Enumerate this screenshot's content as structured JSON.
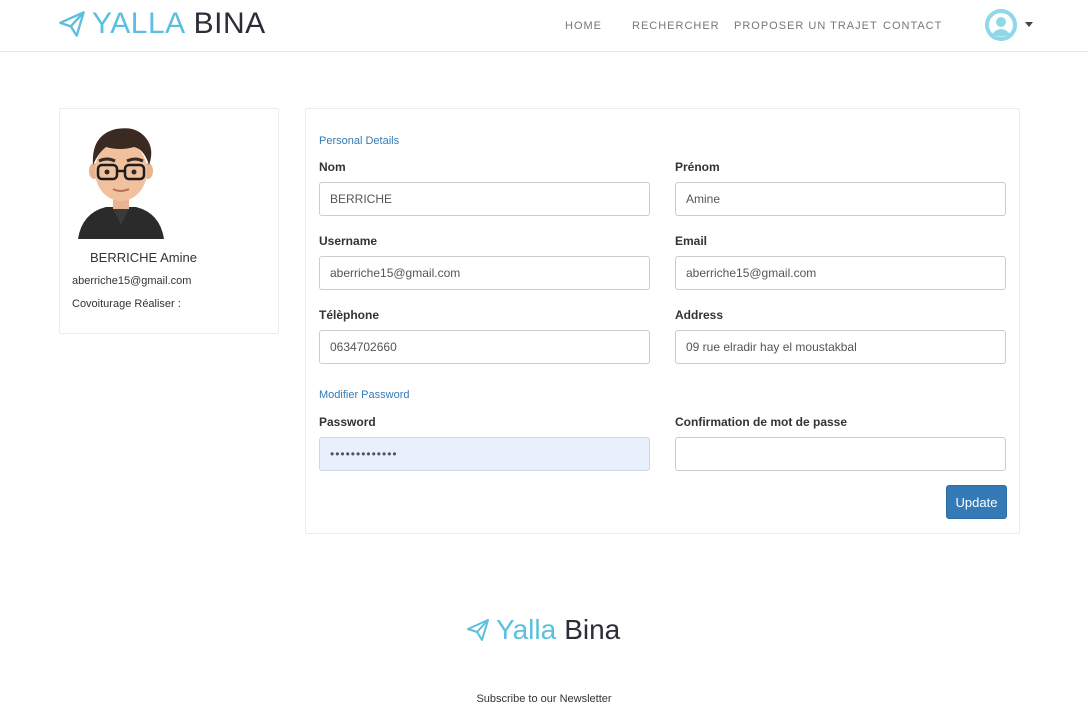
{
  "brand": {
    "part1": "YALLA",
    "part2": "BINA"
  },
  "nav": {
    "home": "HOME",
    "search": "RECHERCHER",
    "propose": "PROPOSER UN TRAJET",
    "contact": "CONTACT"
  },
  "profile": {
    "name": "BERRICHE Amine",
    "email": "aberriche15@gmail.com",
    "covoiturage_label": "Covoiturage Réaliser :"
  },
  "form": {
    "personal_title": "Personal Details",
    "nom_label": "Nom",
    "nom_value": "BERRICHE",
    "prenom_label": "Prénom",
    "prenom_value": "Amine",
    "username_label": "Username",
    "username_value": "aberriche15@gmail.com",
    "email_label": "Email",
    "email_value": "aberriche15@gmail.com",
    "telephone_label": "Télèphone",
    "telephone_value": "0634702660",
    "address_label": "Address",
    "address_value": "09 rue elradir hay el moustakbal",
    "password_title": "Modifier Password",
    "password_label": "Password",
    "password_value": "•••••••••••••",
    "confirm_label": "Confirmation de mot de passe",
    "confirm_value": "",
    "update_label": "Update"
  },
  "footer": {
    "brand_part1": "Yalla",
    "brand_part2": "Bina",
    "newsletter": "Subscribe to our Newsletter"
  },
  "colors": {
    "brand_accent": "#5bc0de",
    "brand_dark": "#2d2d3a",
    "primary_button": "#337ab7",
    "autofill_bg": "#e8f0fe"
  }
}
